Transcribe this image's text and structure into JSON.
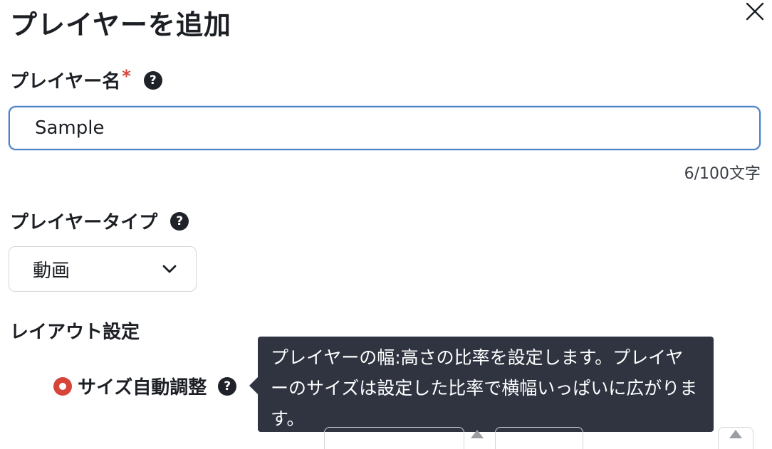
{
  "dialog": {
    "title": "プレイヤーを追加",
    "close_icon": "close-icon"
  },
  "player_name": {
    "label": "プレイヤー名",
    "required_mark": "*",
    "help_glyph": "?",
    "value": "Sample",
    "counter": "6/100文字"
  },
  "player_type": {
    "label": "プレイヤータイプ",
    "help_glyph": "?",
    "selected": "動画",
    "chevron_icon": "chevron-down-icon"
  },
  "layout": {
    "section_label": "レイアウト設定",
    "auto_size_label": "サイズ自動調整",
    "auto_size_selected": true,
    "help_glyph": "?"
  },
  "tooltip": {
    "text": "プレイヤーの幅:高さの比率を設定します。プレイヤーのサイズは設定した比率で横幅いっぱいに広がります。"
  },
  "colors": {
    "accent_blue": "#4e83c6",
    "required_red": "#d7443a",
    "tooltip_bg": "#2f3440"
  }
}
